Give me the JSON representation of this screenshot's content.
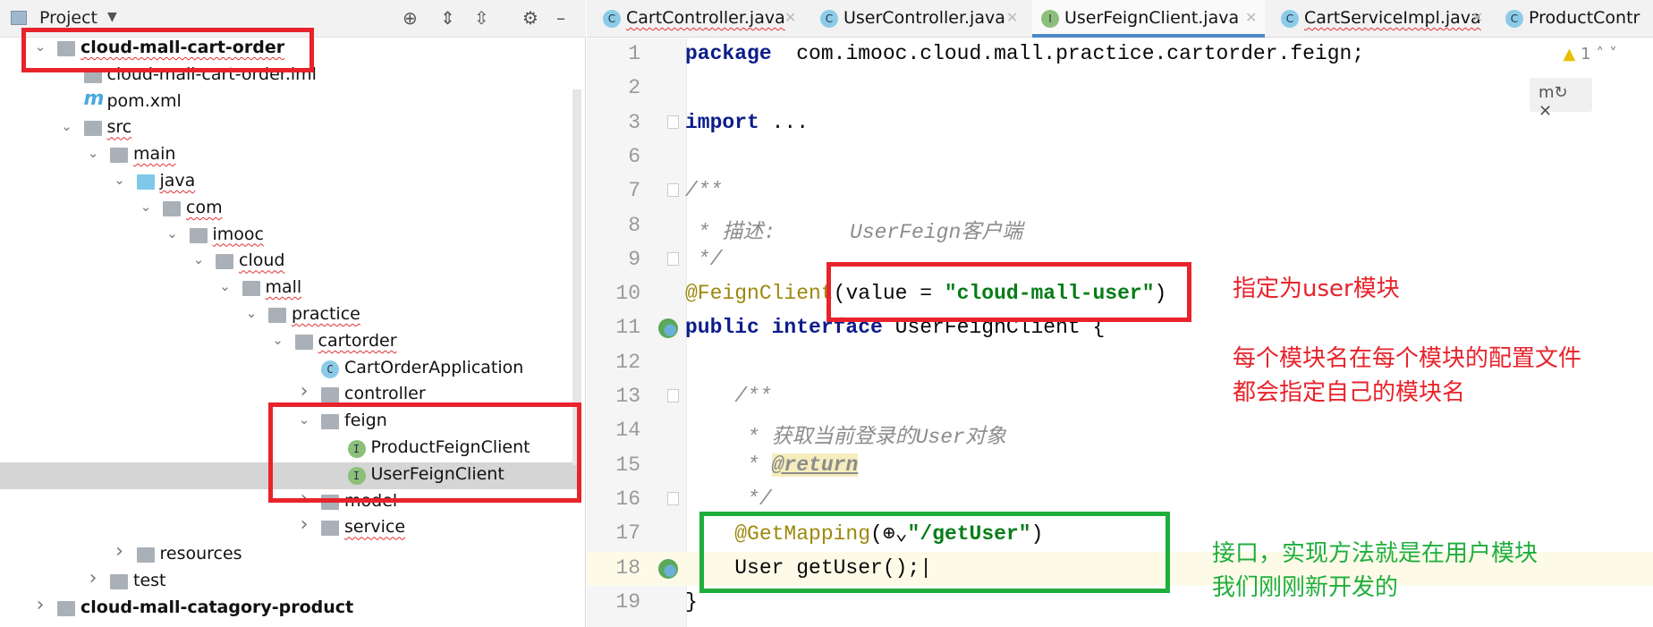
{
  "project_panel": {
    "title": "Project",
    "tree": [
      {
        "label": "cloud-mall-cart-order",
        "level": 0,
        "chev": "down",
        "icon": "module",
        "bold": true,
        "err": true
      },
      {
        "label": "cloud-mall-cart-order.iml",
        "level": 1,
        "chev": "",
        "icon": "file"
      },
      {
        "label": "pom.xml",
        "level": 1,
        "chev": "",
        "icon": "maven"
      },
      {
        "label": "src",
        "level": 1,
        "chev": "down",
        "icon": "folder",
        "err": true
      },
      {
        "label": "main",
        "level": 2,
        "chev": "down",
        "icon": "folder",
        "err": true
      },
      {
        "label": "java",
        "level": 3,
        "chev": "down",
        "icon": "folder-blue",
        "err": true
      },
      {
        "label": "com",
        "level": 4,
        "chev": "down",
        "icon": "package",
        "err": true
      },
      {
        "label": "imooc",
        "level": 5,
        "chev": "down",
        "icon": "package",
        "err": true
      },
      {
        "label": "cloud",
        "level": 6,
        "chev": "down",
        "icon": "package",
        "err": true
      },
      {
        "label": "mall",
        "level": 7,
        "chev": "down",
        "icon": "package",
        "err": true
      },
      {
        "label": "practice",
        "level": 8,
        "chev": "down",
        "icon": "package",
        "err": true
      },
      {
        "label": "cartorder",
        "level": 9,
        "chev": "down",
        "icon": "package",
        "err": true
      },
      {
        "label": "CartOrderApplication",
        "level": 10,
        "chev": "",
        "icon": "class"
      },
      {
        "label": "controller",
        "level": 10,
        "chev": "right",
        "icon": "package",
        "err": true
      },
      {
        "label": "feign",
        "level": 10,
        "chev": "down",
        "icon": "package"
      },
      {
        "label": "ProductFeignClient",
        "level": 11,
        "chev": "",
        "icon": "interface"
      },
      {
        "label": "UserFeignClient",
        "level": 11,
        "chev": "",
        "icon": "interface",
        "selected": true
      },
      {
        "label": "model",
        "level": 10,
        "chev": "right",
        "icon": "package"
      },
      {
        "label": "service",
        "level": 10,
        "chev": "right",
        "icon": "package",
        "err": true
      },
      {
        "label": "resources",
        "level": 3,
        "chev": "right",
        "icon": "folder"
      },
      {
        "label": "test",
        "level": 2,
        "chev": "right",
        "icon": "folder"
      },
      {
        "label": "cloud-mall-catagory-product",
        "level": 0,
        "chev": "right",
        "icon": "module",
        "bold": true
      }
    ]
  },
  "tabs": [
    {
      "label": "CartController.java",
      "icon": "C",
      "err": true
    },
    {
      "label": "UserController.java",
      "icon": "C"
    },
    {
      "label": "UserFeignClient.java",
      "icon": "I",
      "active": true
    },
    {
      "label": "CartServiceImpl.java",
      "icon": "C",
      "err": true
    },
    {
      "label": "ProductContr",
      "icon": "C"
    }
  ],
  "editor": {
    "warning_count": "1",
    "lines": [
      {
        "n": "1",
        "tokens": [
          [
            "kw",
            "package"
          ],
          [
            "",
            "  com.imooc.cloud.mall.practice.cartorder.feign;"
          ]
        ]
      },
      {
        "n": "2",
        "tokens": []
      },
      {
        "n": "3",
        "tokens": [
          [
            "kw",
            "import"
          ],
          [
            "",
            " ..."
          ]
        ],
        "fold": true
      },
      {
        "n": "6",
        "tokens": []
      },
      {
        "n": "7",
        "tokens": [
          [
            "cm",
            "/**"
          ]
        ],
        "fold": true
      },
      {
        "n": "8",
        "tokens": [
          [
            "cm",
            " * 描述:      UserFeign客户端"
          ]
        ]
      },
      {
        "n": "9",
        "tokens": [
          [
            "cm",
            " */"
          ]
        ],
        "fold": true
      },
      {
        "n": "10",
        "tokens": [
          [
            "an",
            "@FeignClient"
          ],
          [
            "",
            "(value = "
          ],
          [
            "st",
            "\"cloud-mall-user\""
          ],
          [
            "",
            ")"
          ]
        ]
      },
      {
        "n": "11",
        "tokens": [
          [
            "kw",
            "public interface"
          ],
          [
            "",
            " UserFeignClient {"
          ]
        ],
        "gicon": true
      },
      {
        "n": "12",
        "tokens": []
      },
      {
        "n": "13",
        "tokens": [
          [
            "cm",
            "    /**"
          ]
        ],
        "fold": true
      },
      {
        "n": "14",
        "tokens": [
          [
            "cm",
            "     * 获取当前登录的User对象"
          ]
        ]
      },
      {
        "n": "15",
        "tokens": [
          [
            "cm",
            "     * "
          ],
          [
            "ret",
            "@return"
          ]
        ]
      },
      {
        "n": "16",
        "tokens": [
          [
            "cm",
            "     */"
          ]
        ],
        "fold": true
      },
      {
        "n": "17",
        "tokens": [
          [
            "an",
            "    @GetMapping"
          ],
          [
            "",
            "(⊕⌄"
          ],
          [
            "st",
            "\"/getUser\""
          ],
          [
            "",
            ")"
          ]
        ]
      },
      {
        "n": "18",
        "tokens": [
          [
            "",
            "    User getUser();|"
          ]
        ],
        "gicon": true,
        "current": true
      },
      {
        "n": "19",
        "tokens": [
          [
            "",
            "}"
          ]
        ]
      }
    ]
  },
  "annotations": {
    "red_note_1": "指定为user模块",
    "red_note_2": "每个模块名在每个模块的配置文件",
    "red_note_3": "都会指定自己的模块名",
    "green_note_1": "接口，实现方法就是在用户模块",
    "green_note_2": "我们刚刚新开发的"
  },
  "colors": {
    "annotation_red": "#e8232b",
    "annotation_green": "#1fae3c",
    "active_tab": "#4a88c7"
  }
}
